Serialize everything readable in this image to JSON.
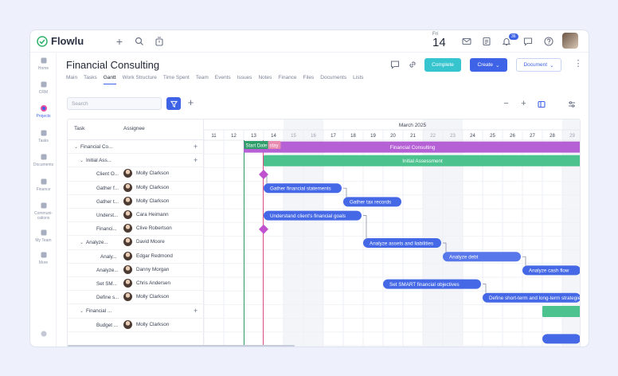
{
  "app": {
    "name": "Flowlu"
  },
  "topbar": {
    "date_dow": "Fri",
    "date_day": "14",
    "notif_count": "36"
  },
  "sidebar": {
    "items": [
      {
        "label": "Home",
        "icon": "home-icon"
      },
      {
        "label": "CRM",
        "icon": "crm-icon"
      },
      {
        "label": "Projects",
        "icon": "projects-icon",
        "active": true
      },
      {
        "label": "Tasks",
        "icon": "tasks-icon"
      },
      {
        "label": "Documents",
        "icon": "documents-icon"
      },
      {
        "label": "Finance",
        "icon": "finance-icon"
      },
      {
        "label": "Communi-cations",
        "icon": "communications-icon"
      },
      {
        "label": "My Team",
        "icon": "team-icon"
      },
      {
        "label": "More",
        "icon": "more-icon"
      }
    ]
  },
  "project": {
    "title": "Financial Consulting",
    "tabs": [
      "Main",
      "Tasks",
      "Gantt",
      "Work Structure",
      "Time Spent",
      "Team",
      "Events",
      "Issues",
      "Notes",
      "Finance",
      "Files",
      "Documents",
      "Lists"
    ],
    "active_tab": "Gantt",
    "complete_label": "Complete",
    "create_label": "Create",
    "document_label": "Document"
  },
  "toolbar": {
    "search_placeholder": "Search"
  },
  "grid": {
    "col_task": "Task",
    "col_assignee": "Assignee",
    "month": "March 2025",
    "days": [
      "11",
      "12",
      "13",
      "14",
      "15",
      "16",
      "17",
      "18",
      "19",
      "20",
      "21",
      "22",
      "23",
      "24",
      "25",
      "26",
      "27",
      "28",
      "29"
    ],
    "start_date_label": "Start Date",
    "today_label": "stay",
    "rows": [
      {
        "name": "Financial Co...",
        "assignee": "",
        "indent": 0,
        "chev": true,
        "plus": true
      },
      {
        "name": "Initial Ass...",
        "assignee": "",
        "indent": 1,
        "chev": true,
        "plus": true
      },
      {
        "name": "Client O...",
        "assignee": "Molly Clarkson",
        "indent": 2
      },
      {
        "name": "Gather f...",
        "assignee": "Molly Clarkson",
        "indent": 2
      },
      {
        "name": "Gather t...",
        "assignee": "Molly Clarkson",
        "indent": 2
      },
      {
        "name": "Underst...",
        "assignee": "Cara Heimann",
        "indent": 2
      },
      {
        "name": "Financi...",
        "assignee": "Clive Robertson",
        "indent": 2
      },
      {
        "name": "Analyze...",
        "assignee": "David Moore",
        "indent": 1,
        "chev": true
      },
      {
        "name": "Analy...",
        "assignee": "Edgar Redmond",
        "indent": 3
      },
      {
        "name": "Analyze...",
        "assignee": "Danny Morgan",
        "indent": 2
      },
      {
        "name": "Set SM...",
        "assignee": "Chris Andersen",
        "indent": 2
      },
      {
        "name": "Define s...",
        "assignee": "Molly Clarkson",
        "indent": 2
      },
      {
        "name": "Financial ...",
        "assignee": "",
        "indent": 1,
        "chev": true,
        "plus": true
      },
      {
        "name": "Budget ...",
        "assignee": "Molly Clarkson",
        "indent": 2
      },
      {
        "name": "",
        "assignee": "",
        "indent": 2
      }
    ]
  },
  "bars": [
    {
      "row": 0,
      "label": "Financial Consulting",
      "start": 2,
      "end": 19,
      "color": "#b660d6",
      "type": "summary"
    },
    {
      "row": 1,
      "label": "Initial Assessment",
      "start": 3,
      "end": 19,
      "color": "#4cc38f",
      "type": "summary"
    },
    {
      "row": 2,
      "label": "",
      "start": 3,
      "type": "milestone",
      "color": "#c052d0"
    },
    {
      "row": 3,
      "label": "Gather financial statements",
      "start": 3,
      "end": 7,
      "color": "#4468e6",
      "type": "task"
    },
    {
      "row": 4,
      "label": "Gather tax records",
      "start": 7,
      "end": 10,
      "color": "#4468e6",
      "type": "task"
    },
    {
      "row": 5,
      "label": "Understand client's financial goals",
      "start": 3,
      "end": 8,
      "color": "#4468e6",
      "type": "task"
    },
    {
      "row": 6,
      "label": "",
      "start": 3,
      "type": "milestone",
      "color": "#c052d0"
    },
    {
      "row": 7,
      "label": "Analyze assets and liabilities",
      "start": 8,
      "end": 12,
      "color": "#4468e6",
      "type": "task"
    },
    {
      "row": 8,
      "label": "Analyze debt",
      "start": 12,
      "end": 16,
      "color": "#5777ea",
      "type": "task"
    },
    {
      "row": 9,
      "label": "Analyze cash flow",
      "start": 16,
      "end": 19,
      "color": "#4468e6",
      "type": "task"
    },
    {
      "row": 10,
      "label": "Set SMART financial objectives",
      "start": 9,
      "end": 14,
      "color": "#4468e6",
      "type": "task"
    },
    {
      "row": 11,
      "label": "Define short-term and long-term strategies",
      "start": 14,
      "end": 19,
      "color": "#4468e6",
      "type": "task"
    },
    {
      "row": 12,
      "label": "",
      "start": 17,
      "end": 19,
      "color": "#4cc38f",
      "type": "summary"
    },
    {
      "row": 14,
      "label": "",
      "start": 17,
      "end": 19,
      "color": "#4468e6",
      "type": "task"
    }
  ]
}
